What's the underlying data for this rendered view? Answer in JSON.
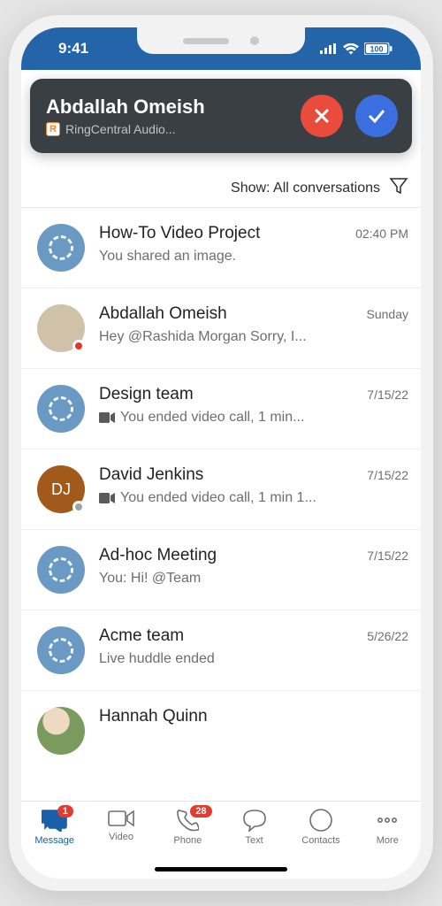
{
  "status": {
    "time": "9:41",
    "battery": "100"
  },
  "call": {
    "name": "Abdallah Omeish",
    "subtitle": "RingCentral Audio...",
    "rc_glyph": "R"
  },
  "filter": {
    "label": "Show: All conversations"
  },
  "conversations": [
    {
      "title": "How-To Video Project",
      "message": "You shared an image.",
      "time": "02:40 PM",
      "avatar": "group",
      "video": false
    },
    {
      "title": "Abdallah Omeish",
      "message": "Hey @Rashida Morgan Sorry, I...",
      "time": "Sunday",
      "avatar": "photo",
      "presence": "red",
      "video": false
    },
    {
      "title": "Design team",
      "message": "You ended video call, 1 min...",
      "time": "7/15/22",
      "avatar": "group",
      "video": true
    },
    {
      "title": "David Jenkins",
      "message": "You ended video call, 1 min 1...",
      "time": "7/15/22",
      "avatar": "initials",
      "initials": "DJ",
      "presence": "gray",
      "video": true
    },
    {
      "title": "Ad-hoc Meeting",
      "message": "You: Hi! @Team",
      "time": "7/15/22",
      "avatar": "group",
      "video": false
    },
    {
      "title": "Acme team",
      "message": "Live huddle ended",
      "time": "5/26/22",
      "avatar": "group",
      "video": false
    },
    {
      "title": "Hannah Quinn",
      "message": "",
      "time": "",
      "avatar": "photo",
      "video": false
    }
  ],
  "nav": {
    "items": [
      {
        "label": "Message",
        "badge": "1"
      },
      {
        "label": "Video"
      },
      {
        "label": "Phone",
        "badge": "28"
      },
      {
        "label": "Text"
      },
      {
        "label": "Contacts"
      },
      {
        "label": "More"
      }
    ]
  }
}
